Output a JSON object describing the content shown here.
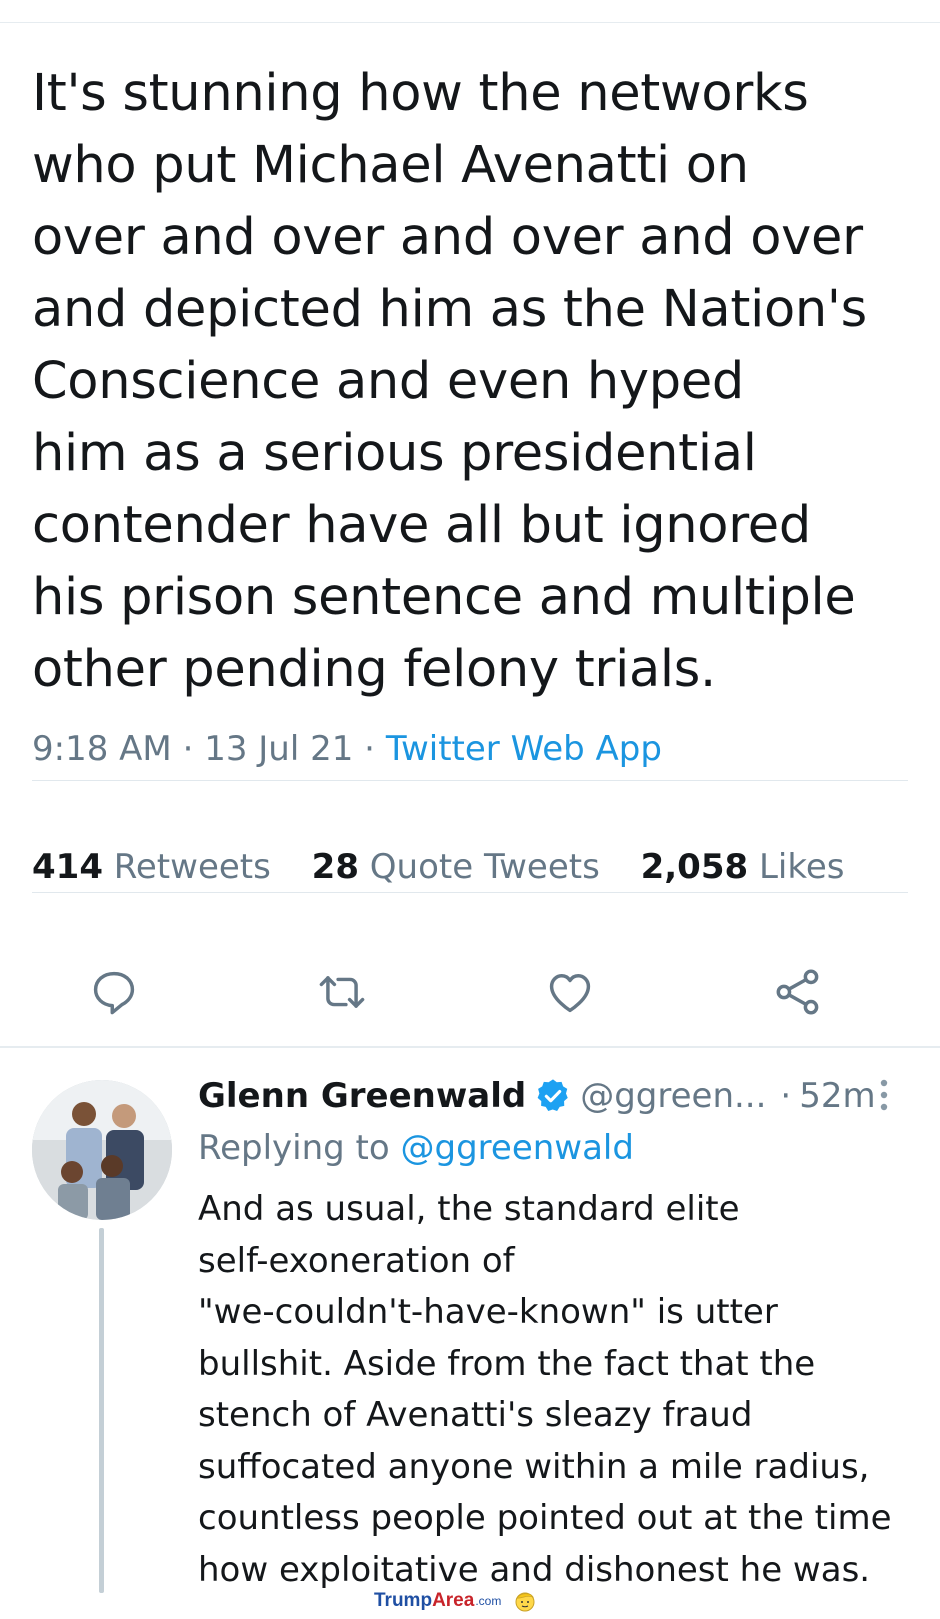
{
  "tweet": {
    "text": "It's stunning how the networks\nwho put Michael Avenatti on\nover and over and over and over\nand depicted him as the Nation's\nConscience and even hyped\nhim as a serious presidential\ncontender have all but ignored\nhis prison sentence and multiple\nother pending felony trials.",
    "time": "9:18 AM",
    "date": "13 Jul 21",
    "separator": " · ",
    "source": "Twitter Web App",
    "retweets_count": "414",
    "retweets_label": "Retweets",
    "quotes_count": "28",
    "quotes_label": "Quote Tweets",
    "likes_count": "2,058",
    "likes_label": "Likes"
  },
  "actions": [
    {
      "name": "reply-icon"
    },
    {
      "name": "retweet-icon"
    },
    {
      "name": "like-icon"
    },
    {
      "name": "share-icon"
    }
  ],
  "reply": {
    "name": "Glenn Greenwald",
    "handle": "@ggreen...",
    "dot": "·",
    "time": "52m",
    "replying_prefix": "Replying to",
    "replying_handle": "@ggreenwald",
    "text": "And as usual, the standard elite\nself-exoneration of\n\"we-couldn't-have-known\" is utter\nbullshit. Aside from the fact that the\nstench of Avenatti's sleazy fraud\nsuffocated anyone within a mile radius,\ncountless people pointed out at the time\nhow exploitative and dishonest he was."
  },
  "watermark": {
    "part1": "Trump",
    "part2": "Area",
    "part3": ".com"
  },
  "colors": {
    "text": "#14171a",
    "secondary": "#657786",
    "link": "#1b95e0",
    "divider": "#e1e8ed",
    "verified": "#1da1f2"
  }
}
